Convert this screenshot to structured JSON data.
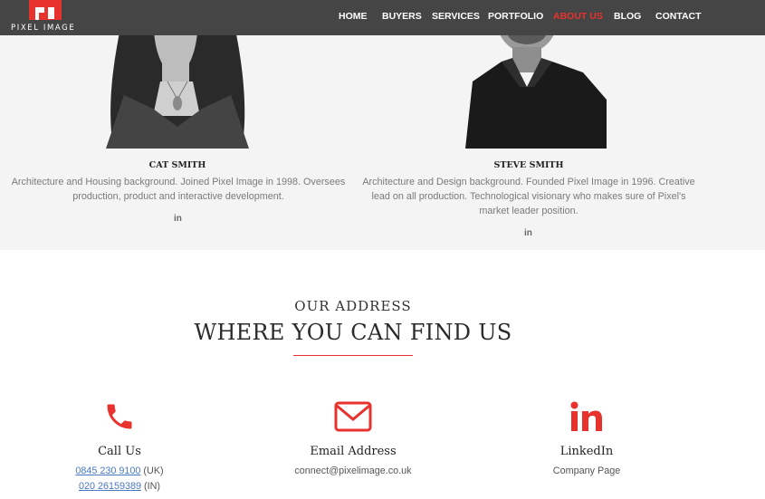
{
  "nav": {
    "logo_text": "PIXEL IMAGE",
    "items": [
      {
        "label": "HOME"
      },
      {
        "label": "BUYERS"
      },
      {
        "label": "SERVICES"
      },
      {
        "label": "PORTFOLIO"
      },
      {
        "label": "ABOUT US",
        "active": true
      },
      {
        "label": "BLOG"
      },
      {
        "label": "CONTACT"
      }
    ]
  },
  "team": [
    {
      "name": "CAT SMITH",
      "bio": "Architecture and Housing background. Joined Pixel Image in 1998. Oversees production, product and interactive development.",
      "social": "in"
    },
    {
      "name": "STEVE SMITH",
      "bio": "Architecture and Design background. Founded Pixel Image in 1996. Creative lead on all production. Technological visionary who makes sure of Pixel's market leader position.",
      "social": "in"
    }
  ],
  "address": {
    "eyebrow": "OUR ADDRESS",
    "title": "WHERE YOU CAN FIND US"
  },
  "contacts": {
    "call": {
      "heading": "Call Us",
      "phone_uk": "0845 230 9100",
      "phone_uk_suffix": "(UK)",
      "phone_in": "020 26159389",
      "phone_in_suffix": "(IN)"
    },
    "email": {
      "heading": "Email Address",
      "value": "connect@pixelimage.co.uk"
    },
    "linkedin": {
      "heading": "LinkedIn",
      "value": "Company Page"
    }
  },
  "colors": {
    "accent": "#e8322d",
    "navbar": "#454545",
    "team_bg": "#f4f4f4",
    "link": "#4a78c2"
  },
  "icons": [
    "phone-icon",
    "envelope-icon",
    "linkedin-icon"
  ]
}
